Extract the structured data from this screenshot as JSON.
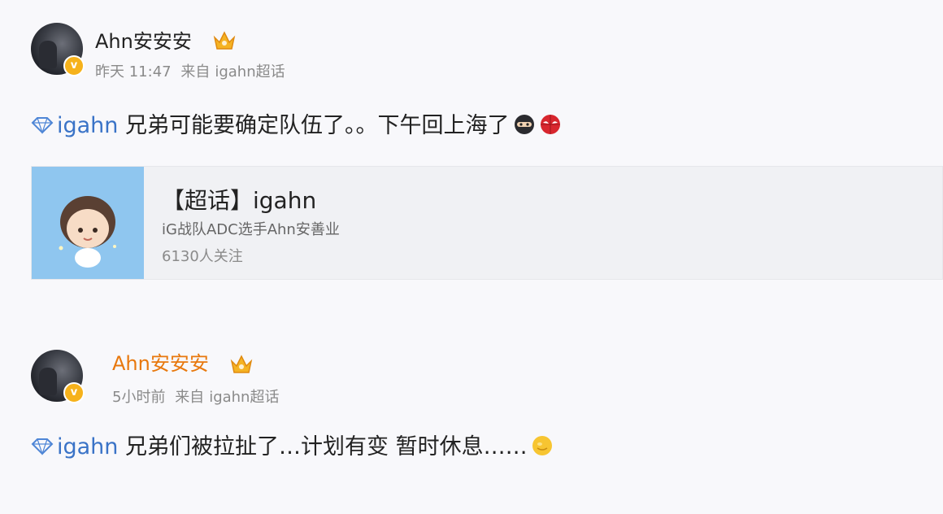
{
  "posts": [
    {
      "username": "Ahn安安安",
      "time": "昨天 11:47",
      "source_prefix": "来自",
      "source": "igahn超话",
      "topic": "igahn",
      "text": " 兄弟可能要确定队伍了。。下午回上海了",
      "emojis": [
        "ninja-emoji",
        "spider-emoji"
      ]
    },
    {
      "username": "Ahn安安安",
      "time": "5小时前",
      "source_prefix": "来自",
      "source": "igahn超话",
      "topic": "igahn",
      "text": " 兄弟们被拉扯了…计划有变 暂时休息……",
      "emojis": [
        "yellow-face-emoji"
      ]
    }
  ],
  "topic_card": {
    "title": "【超话】igahn",
    "description": "iG战队ADC选手Ahn安善业",
    "followers": "6130人关注"
  },
  "colors": {
    "link": "#3a73c7",
    "vip_username": "#e8780d",
    "badge": "#f6b21b",
    "card_cover": "#8fc6ef"
  }
}
